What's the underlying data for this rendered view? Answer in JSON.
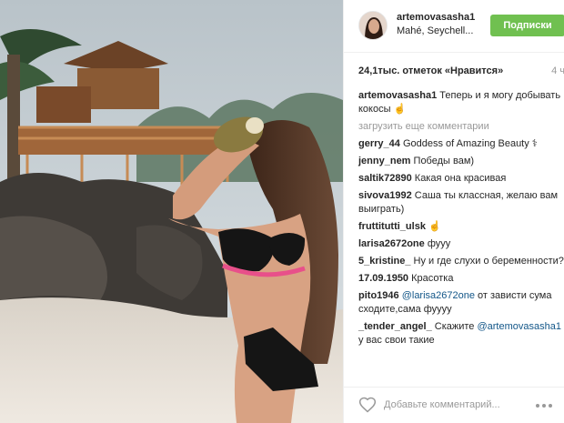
{
  "header": {
    "username": "artemovasasha1",
    "location": "Mahé, Seychell...",
    "follow_label": "Подписки"
  },
  "post": {
    "likes": "24,1тыс. отметок «Нравится»",
    "time": "4 ч"
  },
  "caption": {
    "user": "artemovasasha1",
    "text": "Теперь и я могу добывать кокосы ☝"
  },
  "load_more": "загрузить еще комментарии",
  "comments": [
    {
      "user": "gerry_44",
      "text": "Goddess of Amazing Beauty ⚕"
    },
    {
      "user": "jenny_nem",
      "text": "Победы вам)"
    },
    {
      "user": "saltik72890",
      "text": "Какая она красивая"
    },
    {
      "user": "sivova1992",
      "text": "Саша ты классная, желаю вам выиграть)"
    },
    {
      "user": "fruttitutti_ulsk",
      "text": "☝"
    },
    {
      "user": "larisa2672one",
      "text": "фууу"
    },
    {
      "user": "5_kristine_",
      "text": "Ну и где слухи о беременности?"
    },
    {
      "user": "17.09.1950",
      "text": "Красотка"
    },
    {
      "user": "pito1946",
      "mention": "@larisa2672one",
      "text": "от зависти сума сходите,сама фуууу"
    },
    {
      "user": "_tender_angel_",
      "text": "Скажите",
      "mention": "@artemovasasha1",
      "text2": "у вас свои такие"
    }
  ],
  "comment_box": {
    "placeholder": "Добавьте комментарий..."
  },
  "colors": {
    "follow_green": "#70c050",
    "mention_blue": "#125688",
    "muted_gray": "#999999"
  }
}
